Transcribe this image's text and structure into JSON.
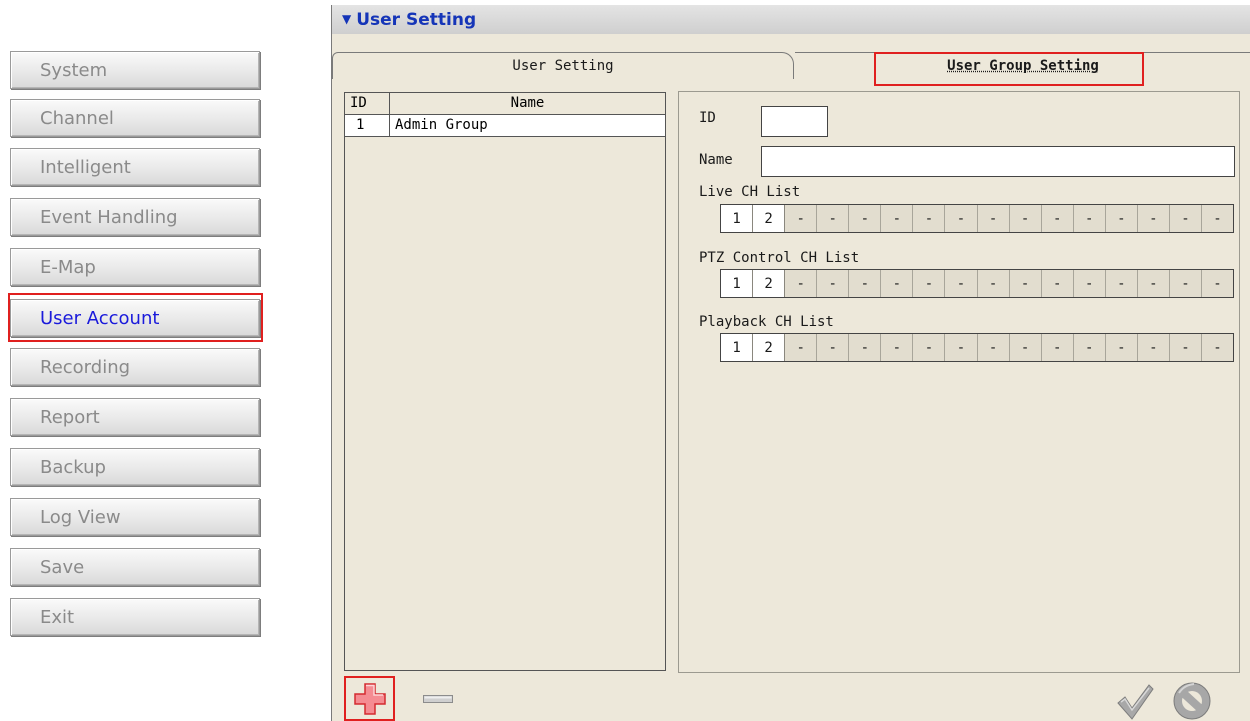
{
  "nav": {
    "items": [
      {
        "label": "System"
      },
      {
        "label": "Channel"
      },
      {
        "label": "Intelligent"
      },
      {
        "label": "Event Handling"
      },
      {
        "label": "E-Map"
      },
      {
        "label": "User Account"
      },
      {
        "label": "Recording"
      },
      {
        "label": "Report"
      },
      {
        "label": "Backup"
      },
      {
        "label": "Log View"
      },
      {
        "label": "Save"
      },
      {
        "label": "Exit"
      }
    ],
    "active_index": 5,
    "active_color": "#1a1adb",
    "inactive_color": "#8a8a8a",
    "highlight_color": "#e0201f"
  },
  "panel": {
    "title": "User Setting",
    "title_icon": "dot-cluster-icon",
    "title_color": "#1535b8",
    "tabs": [
      {
        "label": "User Setting",
        "selected": false
      },
      {
        "label": "User Group Setting",
        "selected": true
      }
    ]
  },
  "group_list": {
    "columns": [
      "ID",
      "Name"
    ],
    "rows": [
      {
        "id": "1",
        "name": "Admin Group"
      }
    ]
  },
  "detail": {
    "id_label": "ID",
    "id_value": "",
    "name_label": "Name",
    "name_value": "",
    "channel_lists": [
      {
        "label": "Live CH List",
        "cells": [
          "1",
          "2",
          "-",
          "-",
          "-",
          "-",
          "-",
          "-",
          "-",
          "-",
          "-",
          "-",
          "-",
          "-",
          "-",
          "-"
        ]
      },
      {
        "label": "PTZ Control CH List",
        "cells": [
          "1",
          "2",
          "-",
          "-",
          "-",
          "-",
          "-",
          "-",
          "-",
          "-",
          "-",
          "-",
          "-",
          "-",
          "-",
          "-"
        ]
      },
      {
        "label": "Playback CH List",
        "cells": [
          "1",
          "2",
          "-",
          "-",
          "-",
          "-",
          "-",
          "-",
          "-",
          "-",
          "-",
          "-",
          "-",
          "-",
          "-",
          "-"
        ]
      }
    ]
  },
  "toolbar": {
    "add_icon": "plus-icon",
    "remove_icon": "minus-icon",
    "ok_icon": "checkmark-icon",
    "cancel_icon": "prohibit-icon"
  }
}
